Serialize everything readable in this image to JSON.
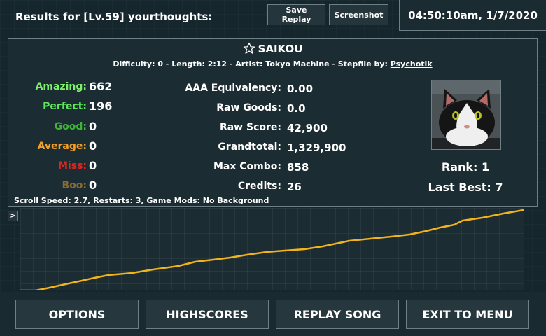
{
  "header": {
    "title": "Results for [Lv.59] yourthoughts:",
    "save_replay": "Save Replay",
    "screenshot": "Screenshot",
    "clock": "04:50:10am, 1/7/2020"
  },
  "song": {
    "title": "SAIKOU",
    "info_prefix": "Difficulty: 0 - Length: 2:12 - Artist: Tokyo Machine - Stepfile by: ",
    "stepfile_author": "Psychotik"
  },
  "judgements": [
    {
      "label": "Amazing:",
      "value": "662",
      "color": "#7ff26a"
    },
    {
      "label": "Perfect:",
      "value": "196",
      "color": "#5ee85a"
    },
    {
      "label": "Good:",
      "value": "0",
      "color": "#3fb23a"
    },
    {
      "label": "Average:",
      "value": "0",
      "color": "#f0a02a"
    },
    {
      "label": "Miss:",
      "value": "0",
      "color": "#e0241e"
    },
    {
      "label": "Boo:",
      "value": "0",
      "color": "#8a6a34"
    }
  ],
  "stats": [
    {
      "label": "AAA Equivalency:",
      "value": "0.00"
    },
    {
      "label": "Raw Goods:",
      "value": "0.0"
    },
    {
      "label": "Raw Score:",
      "value": "42,900"
    },
    {
      "label": "Grandtotal:",
      "value": "1,329,900"
    },
    {
      "label": "Max Combo:",
      "value": "858"
    },
    {
      "label": "Credits:",
      "value": "26"
    }
  ],
  "rank": {
    "rank_text": "Rank: 1",
    "last_best_text": "Last Best: 7"
  },
  "footer_info": "Scroll Speed: 2.7, Restarts: 3, Game Mods: No Background",
  "graph": {
    "toggle_label": ">",
    "line_color": "#f2b418"
  },
  "buttons": {
    "options": "OPTIONS",
    "highscores": "HIGHSCORES",
    "replay": "REPLAY SONG",
    "exit": "EXIT TO MENU"
  }
}
